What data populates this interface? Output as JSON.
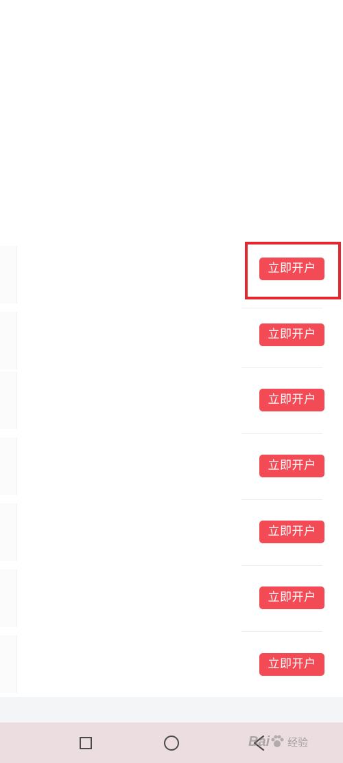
{
  "list": {
    "rows": [
      {
        "button_label": "立即开户",
        "highlighted": true
      },
      {
        "button_label": "立即开户",
        "highlighted": false
      },
      {
        "button_label": "立即开户",
        "highlighted": false
      },
      {
        "button_label": "立即开户",
        "highlighted": false
      },
      {
        "button_label": "立即开户",
        "highlighted": false
      },
      {
        "button_label": "立即开户",
        "highlighted": false
      },
      {
        "button_label": "立即开户",
        "highlighted": false
      }
    ]
  },
  "colors": {
    "button_bg": "#f24b55",
    "highlight_border": "#e3272f",
    "nav_bar_bg": "#ecdde1"
  },
  "nav_bar": {
    "icons": [
      "recent-apps-icon",
      "home-icon",
      "back-icon"
    ]
  },
  "watermark": {
    "brand": "Bai",
    "suffix": "经验"
  }
}
